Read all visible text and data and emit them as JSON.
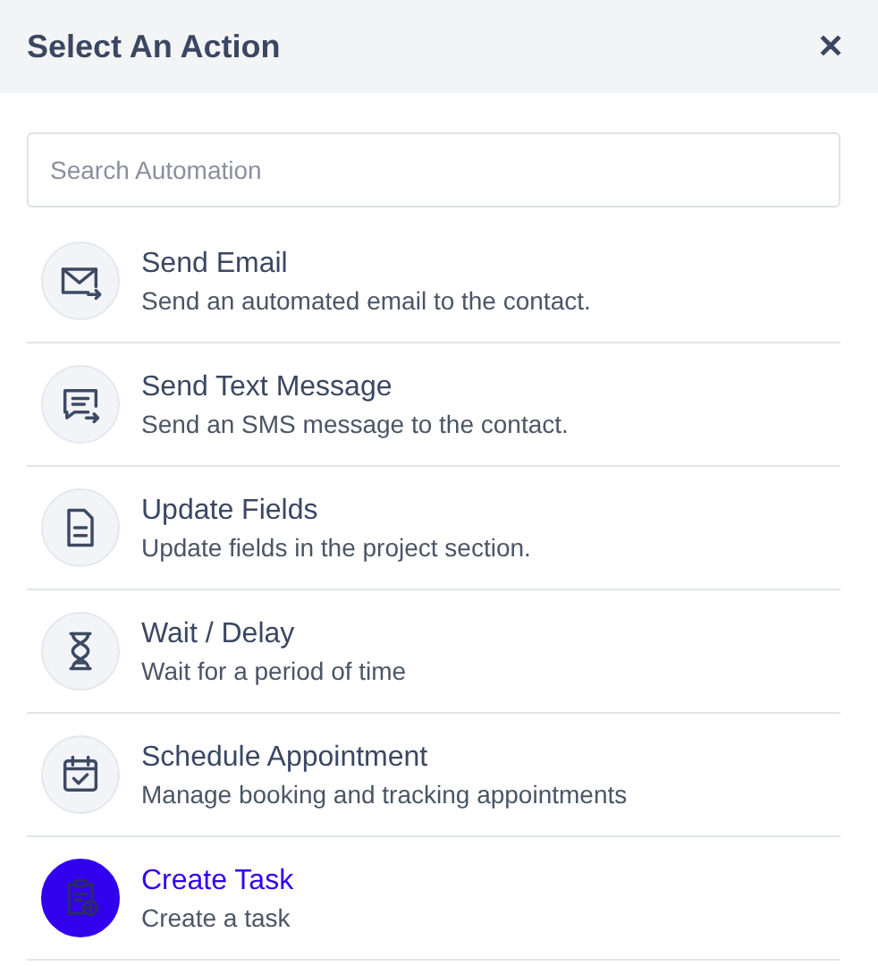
{
  "header": {
    "title": "Select An Action",
    "close": "✕"
  },
  "search": {
    "placeholder": "Search Automation"
  },
  "actions": [
    {
      "kind": "email",
      "title": "Send Email",
      "description": "Send an automated email to the contact.",
      "selected": false
    },
    {
      "kind": "sms",
      "title": "Send Text Message",
      "description": "Send an SMS message to the contact.",
      "selected": false
    },
    {
      "kind": "fields",
      "title": "Update Fields",
      "description": "Update fields in the project section.",
      "selected": false
    },
    {
      "kind": "wait",
      "title": "Wait / Delay",
      "description": "Wait for a period of time",
      "selected": false
    },
    {
      "kind": "calendar",
      "title": "Schedule Appointment",
      "description": "Manage booking and tracking appointments",
      "selected": false
    },
    {
      "kind": "task",
      "title": "Create Task",
      "description": "Create a task",
      "selected": true
    }
  ]
}
